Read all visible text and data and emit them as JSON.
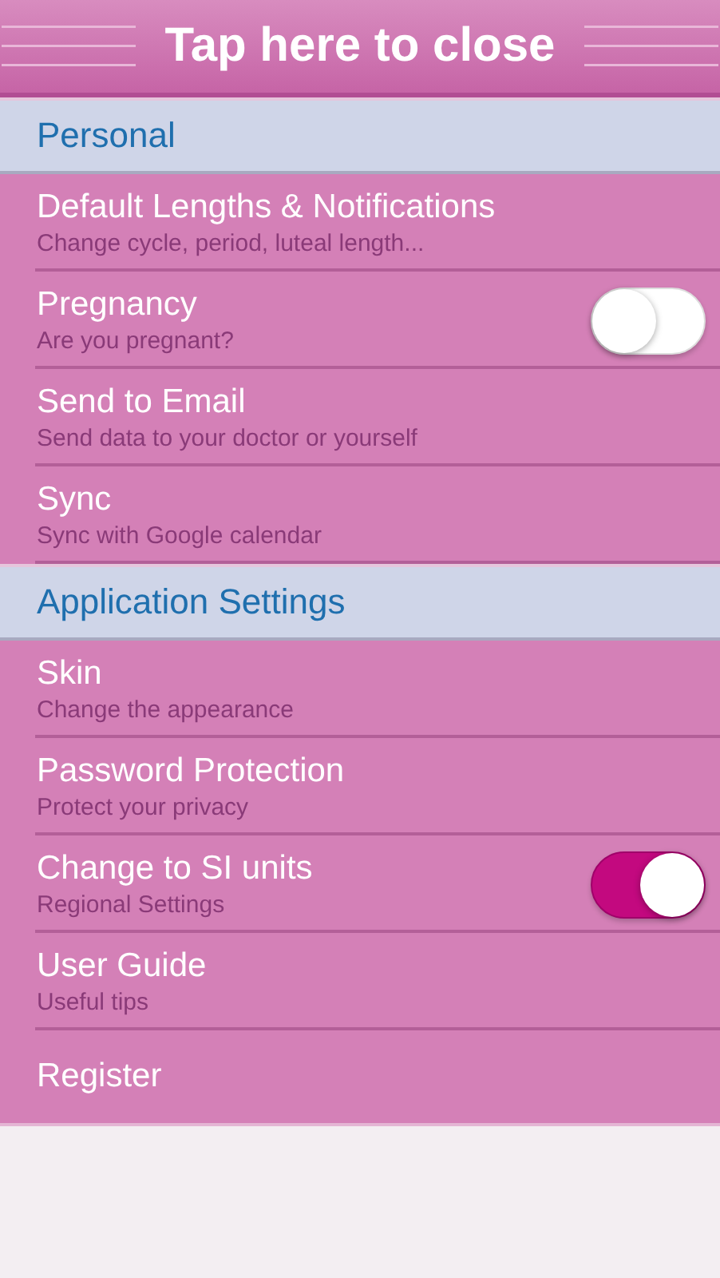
{
  "header": {
    "title": "Tap here to close"
  },
  "sections": [
    {
      "title": "Personal",
      "items": [
        {
          "kind": "link",
          "title": "Default Lengths & Notifications",
          "subtitle": "Change cycle, period, luteal length..."
        },
        {
          "kind": "toggle",
          "title": "Pregnancy",
          "subtitle": "Are you pregnant?",
          "on": false
        },
        {
          "kind": "link",
          "title": "Send to Email",
          "subtitle": "Send data to your doctor or yourself"
        },
        {
          "kind": "link",
          "title": "Sync",
          "subtitle": "Sync with Google calendar"
        }
      ]
    },
    {
      "title": "Application Settings",
      "items": [
        {
          "kind": "link",
          "title": "Skin",
          "subtitle": "Change the appearance"
        },
        {
          "kind": "link",
          "title": "Password Protection",
          "subtitle": "Protect your privacy"
        },
        {
          "kind": "toggle",
          "title": "Change to SI units",
          "subtitle": "Regional Settings",
          "on": true
        },
        {
          "kind": "link",
          "title": "User Guide",
          "subtitle": "Useful tips"
        },
        {
          "kind": "link",
          "title": "Register"
        }
      ]
    }
  ]
}
